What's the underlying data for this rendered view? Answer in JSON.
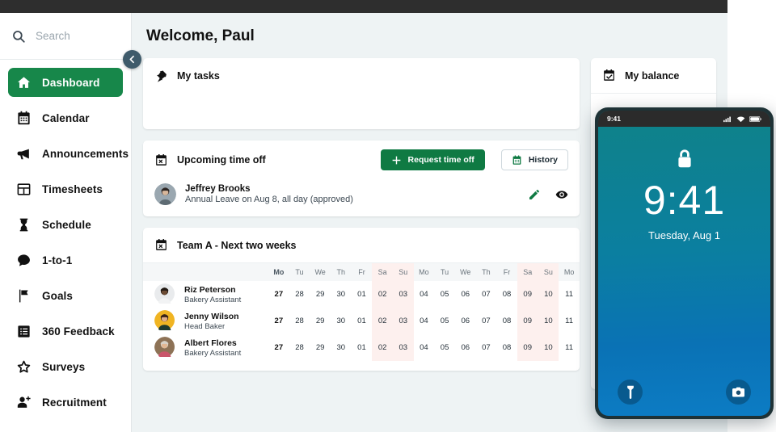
{
  "search": {
    "placeholder": "Search",
    "icon": "search-icon"
  },
  "sidebar": {
    "collapse_icon": "chevron-left-icon",
    "items": [
      {
        "label": "Dashboard",
        "icon": "home-icon",
        "active": true
      },
      {
        "label": "Calendar",
        "icon": "calendar-icon",
        "active": false
      },
      {
        "label": "Announcements",
        "icon": "megaphone-icon",
        "active": false
      },
      {
        "label": "Timesheets",
        "icon": "table-icon",
        "active": false
      },
      {
        "label": "Schedule",
        "icon": "hourglass-icon",
        "active": false
      },
      {
        "label": "1-to-1",
        "icon": "chat-icon",
        "active": false
      },
      {
        "label": "Goals",
        "icon": "flag-icon",
        "active": false
      },
      {
        "label": "360 Feedback",
        "icon": "list-icon",
        "active": false
      },
      {
        "label": "Surveys",
        "icon": "star-icon",
        "active": false
      },
      {
        "label": "Recruitment",
        "icon": "user-plus-icon",
        "active": false
      }
    ]
  },
  "page": {
    "title": "Welcome, Paul"
  },
  "tasks_card": {
    "title": "My tasks",
    "icon": "pin-icon"
  },
  "timeoff_card": {
    "title": "Upcoming time off",
    "icon": "calendar-x-icon",
    "request_button": {
      "label": "Request time off",
      "icon": "plus-icon"
    },
    "history_button": {
      "label": "History",
      "icon": "calendar-icon"
    },
    "entry": {
      "name": "Jeffrey Brooks",
      "detail": "Annual Leave on Aug 8, all day (approved)",
      "edit_icon": "pencil-icon",
      "view_icon": "eye-icon"
    }
  },
  "team_card": {
    "title": "Team A - Next two weeks",
    "icon": "calendar-x-icon",
    "day_headers": [
      "Mo",
      "Tu",
      "We",
      "Th",
      "Fr",
      "Sa",
      "Su",
      "Mo",
      "Tu",
      "We",
      "Th",
      "Fr",
      "Sa",
      "Su",
      "Mo"
    ],
    "dates": [
      "27",
      "28",
      "29",
      "30",
      "01",
      "02",
      "03",
      "04",
      "05",
      "06",
      "07",
      "08",
      "09",
      "10",
      "11"
    ],
    "weekend_indices": [
      5,
      6,
      12,
      13
    ],
    "today_index": 0,
    "members": [
      {
        "name": "Riz Peterson",
        "role": "Bakery Assistant",
        "avatar_color": "#e6e8ea"
      },
      {
        "name": "Jenny Wilson",
        "role": "Head Baker",
        "avatar_color": "#f0b422"
      },
      {
        "name": "Albert Flores",
        "role": "Bakery Assistant",
        "avatar_color": "#9c8063"
      }
    ]
  },
  "balance_card": {
    "title": "My balance",
    "icon": "calendar-check-icon"
  },
  "phone": {
    "status_time": "9:41",
    "signal_icon": "signal-icon",
    "wifi_icon": "wifi-icon",
    "battery_icon": "battery-icon",
    "lock_icon": "lock-icon",
    "clock": "9:41",
    "date": "Tuesday, Aug 1",
    "flashlight_icon": "flashlight-icon",
    "camera_icon": "camera-icon"
  },
  "colors": {
    "accent_green": "#17874a",
    "button_green": "#0f7a43",
    "weekend_tint": "#fdf0ee",
    "titlebar": "#2e2e2e",
    "page_bg": "#eef3f4"
  }
}
